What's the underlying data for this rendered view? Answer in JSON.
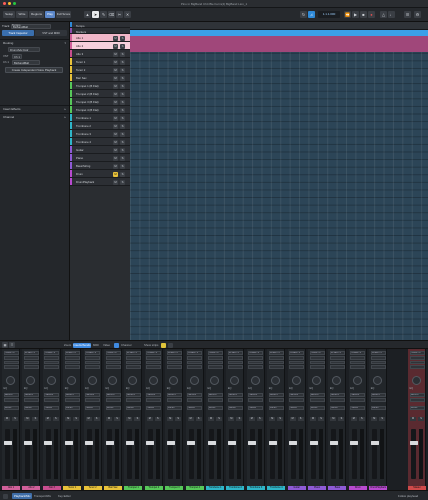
{
  "window": {
    "title": "Pino in BigBand Ch4 Ble Ferm(4) BigBand Lion_1"
  },
  "toolbar": {
    "left_buttons": [
      "Setup",
      "Write",
      "Regions",
      "Play",
      "Full Score"
    ],
    "active_button": "Play",
    "transport_time": "1.1.1.000"
  },
  "inspector": {
    "tabs": [
      "Track Inspector",
      "VST and MIDI"
    ],
    "track_label": "Track",
    "track_name": "BigbandBall",
    "routing_label": "Routing",
    "routing_target": "Drum/Adv.Instr",
    "ch_label": "Ch 1",
    "vst_label": "VST",
    "vst_value": "BigbandBall",
    "create_button": "Create Independent Voice Playback",
    "insert_effects": "Insert Effects",
    "channel": "Channel"
  },
  "arrange": {
    "ruler_label": "Tempo"
  },
  "tracks": [
    {
      "name": "Tempo",
      "color": "#2f8ad8",
      "bg": "#2c2f34",
      "h": 6,
      "buttons": false
    },
    {
      "name": "Markers",
      "color": "#8a4fa8",
      "bg": "#2c2f34",
      "h": 6,
      "buttons": false
    },
    {
      "name": "Alto 1",
      "color": "#d0609a",
      "bg": "#f0b6c8",
      "h": 8,
      "buttons": true
    },
    {
      "name": "Alto 2",
      "color": "#d0609a",
      "bg": "#f6d0dc",
      "h": 8,
      "buttons": true
    },
    {
      "name": "Alto 3",
      "color": "#c74e8f",
      "bg": "#2c2f34",
      "h": 8,
      "buttons": true
    },
    {
      "name": "Tenor 1",
      "color": "#e8c23a",
      "bg": "#2c2f34",
      "h": 8,
      "buttons": true
    },
    {
      "name": "Tenor 2",
      "color": "#e8c23a",
      "bg": "#2c2f34",
      "h": 8,
      "buttons": true
    },
    {
      "name": "Bari Sax",
      "color": "#e8c23a",
      "bg": "#2c2f34",
      "h": 8,
      "buttons": true
    },
    {
      "name": "Trumpet 1 (B Flat)",
      "color": "#57c85a",
      "bg": "#2c2f34",
      "h": 8,
      "buttons": true
    },
    {
      "name": "Trumpet 2 (B Flat)",
      "color": "#57c85a",
      "bg": "#2c2f34",
      "h": 8,
      "buttons": true
    },
    {
      "name": "Trumpet 3 (B Flat)",
      "color": "#57c85a",
      "bg": "#2c2f34",
      "h": 8,
      "buttons": true
    },
    {
      "name": "Trumpet 4 (B Flat)",
      "color": "#57c85a",
      "bg": "#2c2f34",
      "h": 8,
      "buttons": true
    },
    {
      "name": "Trombone 1",
      "color": "#2fb6c9",
      "bg": "#2c2f34",
      "h": 8,
      "buttons": true
    },
    {
      "name": "Trombone 2",
      "color": "#2fb6c9",
      "bg": "#2c2f34",
      "h": 8,
      "buttons": true
    },
    {
      "name": "Trombone 3",
      "color": "#2fb6c9",
      "bg": "#2c2f34",
      "h": 8,
      "buttons": true
    },
    {
      "name": "Trombone 4",
      "color": "#2fb6c9",
      "bg": "#2c2f34",
      "h": 8,
      "buttons": true
    },
    {
      "name": "Guitar",
      "color": "#8e5ad6",
      "bg": "#2c2f34",
      "h": 8,
      "buttons": true
    },
    {
      "name": "Piano",
      "color": "#8e5ad6",
      "bg": "#2c2f34",
      "h": 8,
      "buttons": true
    },
    {
      "name": "Bass/String",
      "color": "#8e5ad6",
      "bg": "#2c2f34",
      "h": 8,
      "buttons": true
    },
    {
      "name": "Drum",
      "color": "#b84ad0",
      "bg": "#2c2f34",
      "h": 8,
      "buttons": true,
      "solo": true
    },
    {
      "name": "DrumPlayback",
      "color": "#b84ad0",
      "bg": "#2c2f34",
      "h": 8,
      "buttons": true
    }
  ],
  "mixer_bar": {
    "zoom_label": "Zoom",
    "buttons": [
      "Inserts/Sends",
      "MIDI",
      "Video",
      "Channel"
    ],
    "controls_label": "Show strips"
  },
  "mixer": {
    "inserts_label": "INSERTS",
    "sends_label": "SENDS",
    "eq_label": "EQ",
    "route_label": "Stereo",
    "channels": [
      {
        "label": "Alto 1",
        "color": "#d0609a"
      },
      {
        "label": "Alto 2",
        "color": "#d0609a"
      },
      {
        "label": "Alto 3",
        "color": "#c74e8f"
      },
      {
        "label": "Tenor 1",
        "color": "#e8c23a"
      },
      {
        "label": "Tenor 2",
        "color": "#e8c23a"
      },
      {
        "label": "Bari Sax",
        "color": "#e8c23a"
      },
      {
        "label": "Trumpet 1",
        "color": "#57c85a"
      },
      {
        "label": "Trumpet 2",
        "color": "#57c85a"
      },
      {
        "label": "Trumpet 3",
        "color": "#57c85a"
      },
      {
        "label": "Trumpet 4",
        "color": "#57c85a"
      },
      {
        "label": "Trombone 1",
        "color": "#2fb6c9"
      },
      {
        "label": "Trombone 2",
        "color": "#2fb6c9"
      },
      {
        "label": "Trombone 3",
        "color": "#2fb6c9"
      },
      {
        "label": "Trombone 4",
        "color": "#2fb6c9"
      },
      {
        "label": "Guitar",
        "color": "#8e5ad6"
      },
      {
        "label": "Piano",
        "color": "#8e5ad6"
      },
      {
        "label": "Bass",
        "color": "#8e5ad6"
      },
      {
        "label": "Drum",
        "color": "#b84ad0"
      },
      {
        "label": "DrumPlayback",
        "color": "#b84ad0"
      },
      {
        "label": "Master",
        "color": "#d04a4a"
      }
    ]
  },
  "statusbar": {
    "tabs": [
      "Playback/Mix",
      "Transport/Mix",
      "Key Editor"
    ],
    "active_tab": "Playback/Mix",
    "right_text": "Follow playhead"
  },
  "colors": {
    "accent": "#2f8ad8",
    "arrange_bg": "#2c4557",
    "selected_region": "#b4446f"
  }
}
